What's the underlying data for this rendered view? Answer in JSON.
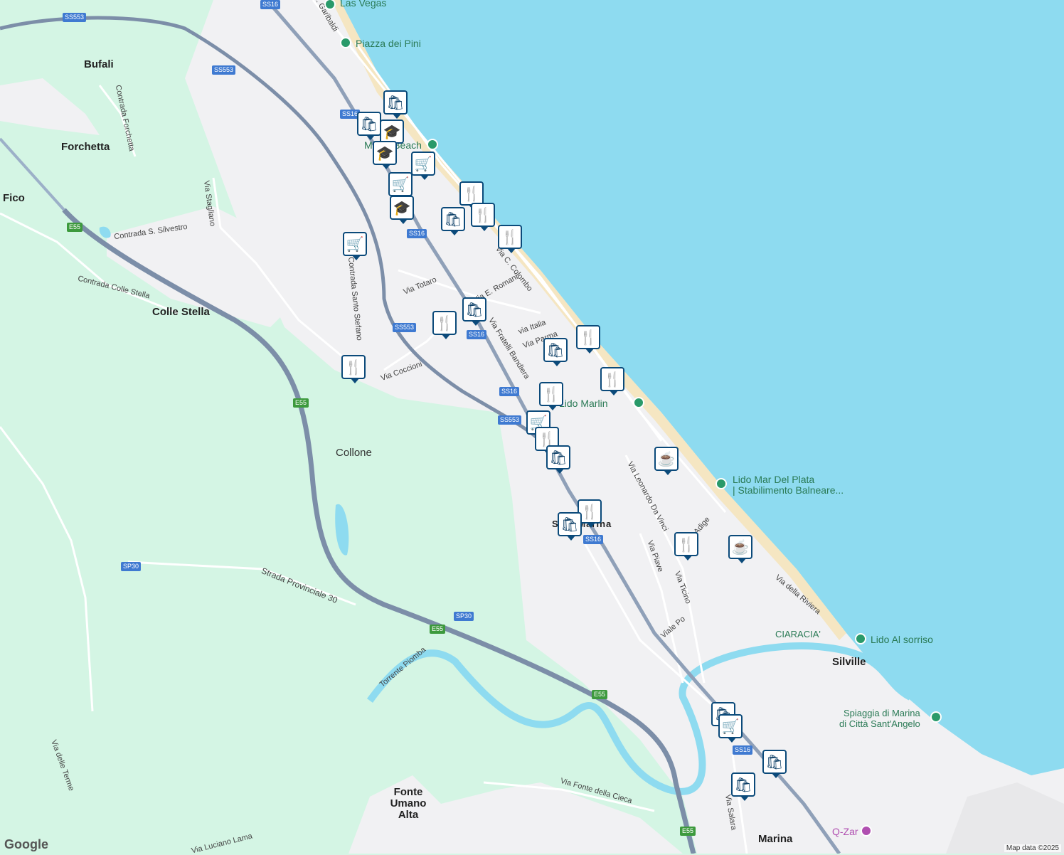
{
  "map": {
    "attribution": "Map data ©2025",
    "logo": "Google",
    "places": [
      {
        "name": "Bufali"
      },
      {
        "name": "Forchetta"
      },
      {
        "name": "Fico"
      },
      {
        "name": "Colle Stella"
      },
      {
        "name": "Fonte Umano Alta"
      },
      {
        "name": "Marina"
      },
      {
        "name": "Silville"
      },
      {
        "name": "Collone"
      },
      {
        "name": "Silvi Marina"
      }
    ],
    "roads": [
      "Via G. Garibaldi",
      "Contrada Forchetta",
      "Contrada S. Silvestro",
      "Via Stagliano",
      "Contrada Colle Stella",
      "Contrada Santo Stefano",
      "Via Totaro",
      "Via E. Romani",
      "Via Coccioni",
      "Via Fratelli Bandiera",
      "via Italia",
      "Via Parma",
      "Via C. Colombo",
      "Via Leonardo Da Vinci",
      "Via Adige",
      "Via Piave",
      "Via Ticino",
      "Viale Po",
      "Via della Riviera",
      "Strada Provinciale 30",
      "Torrente Piomba",
      "Via Fonte della Cieca",
      "Via Salara",
      "Via delle Terme",
      "Via Luciano Lama"
    ],
    "shields": [
      "SS16",
      "SS553",
      "E55",
      "SP30"
    ],
    "pois": [
      {
        "name": "Las Vegas"
      },
      {
        "name": "Piazza dei Pini"
      },
      {
        "name": "Miami Beach"
      },
      {
        "name": "Lido Marlin"
      },
      {
        "name": "Lido Mar Del Plata"
      },
      {
        "name": "| Stabilimento Balneare..."
      },
      {
        "name": "CIARACIA'"
      },
      {
        "name": "Lido Al sorriso"
      },
      {
        "name": "Spiaggia di Marina"
      },
      {
        "name": "di Città Sant'Angelo"
      },
      {
        "name": "Q-Zar"
      }
    ],
    "markers": [
      "shopping-bag-icon",
      "shopping-bag-icon",
      "school-icon",
      "school-icon",
      "shopping-cart-icon",
      "shopping-cart-icon",
      "school-icon",
      "restaurant-icon",
      "shopping-bag-icon",
      "restaurant-icon",
      "restaurant-icon",
      "shopping-cart-icon",
      "shopping-bag-icon",
      "restaurant-icon",
      "restaurant-icon",
      "shopping-bag-icon",
      "restaurant-icon",
      "restaurant-icon",
      "restaurant-icon",
      "shopping-cart-icon",
      "restaurant-icon",
      "shopping-bag-icon",
      "coffee-icon",
      "restaurant-icon",
      "shopping-bag-icon",
      "restaurant-icon",
      "coffee-icon",
      "shopping-bag-icon",
      "shopping-cart-icon",
      "shopping-bag-icon",
      "shopping-bag-icon"
    ],
    "colors": {
      "sea": "#8edbf0",
      "land": "#f2f2f4",
      "green": "#d4f5e4",
      "highway": "#7c8ea8",
      "beach": "#f5e6c2",
      "marker": "#0b4a7a"
    }
  }
}
